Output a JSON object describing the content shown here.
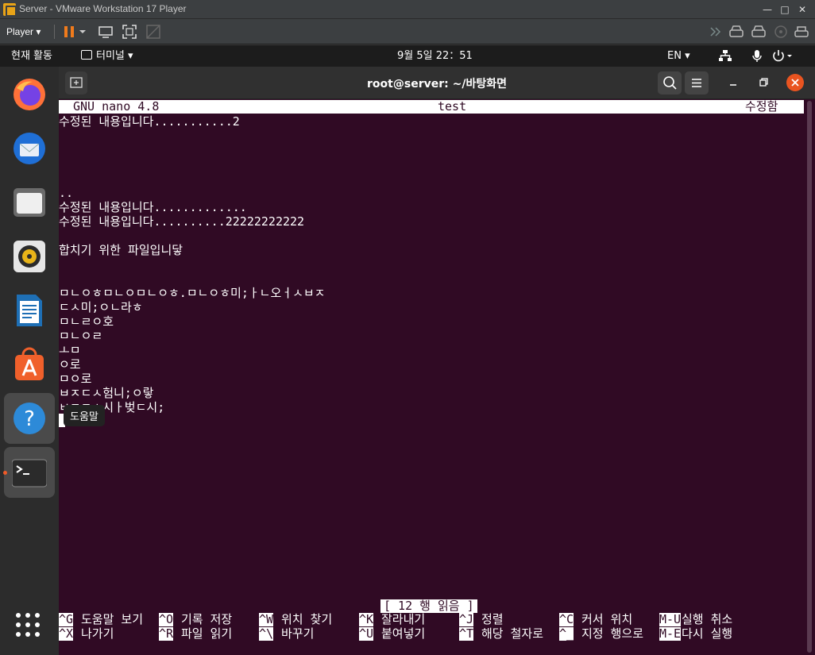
{
  "vm": {
    "title": "Server - VMware Workstation 17 Player",
    "player_menu": "Player"
  },
  "gnome": {
    "activities": "현재 활동",
    "app_menu": "터미널",
    "clock": "9월 5일  22：51",
    "lang": "EN"
  },
  "dock": {
    "items": [
      "firefox-icon",
      "thunderbird-icon",
      "files-icon",
      "rhythmbox-icon",
      "writer-icon",
      "software-icon",
      "help-icon",
      "terminal-icon"
    ],
    "tooltip": "도움말"
  },
  "terminal": {
    "title": "root@server: ~/바탕화면"
  },
  "nano": {
    "version": "GNU nano 4.8",
    "filename": "test",
    "modified": "수정함",
    "lines": [
      "수정된 내용입니다...........2",
      "",
      "",
      "",
      "",
      "..",
      "수정된 내용입니다.............",
      "수정된 내용입니다..........22222222222",
      "",
      "합치기 위한 파일입니닿",
      "",
      "",
      "ㅁㄴㅇㅎㅁㄴㅇㅁㄴㅇㅎ.ㅁㄴㅇㅎ미;ㅏㄴ오ㅓㅅㅂㅈ",
      "ㄷㅅ미;ㅇㄴ라ㅎ",
      "ㅁㄴㄹㅇ호",
      "ㅁㄴㅇㄹ",
      "ㅗㅁ",
      "ㅇ로",
      "ㅁㅇ로",
      "ㅂㅈㄷㅅ험니;ㅇ랗",
      "ㅂㅈㄷㅅ시ㅏ벚ㄷ시;"
    ],
    "status": "[ 12 행 읽음 ]",
    "shortcuts_row1": [
      {
        "key": "^G",
        "label": "도움말 보기"
      },
      {
        "key": "^O",
        "label": "기록 저장"
      },
      {
        "key": "^W",
        "label": "위치 찾기"
      },
      {
        "key": "^K",
        "label": "잘라내기"
      },
      {
        "key": "^J",
        "label": "정렬"
      },
      {
        "key": "^C",
        "label": "커서 위치"
      },
      {
        "key": "M-U",
        "label": "실행 취소"
      }
    ],
    "shortcuts_row2": [
      {
        "key": "^X",
        "label": "나가기"
      },
      {
        "key": "^R",
        "label": "파일 읽기"
      },
      {
        "key": "^\\",
        "label": "바꾸기"
      },
      {
        "key": "^U",
        "label": "붙여넣기"
      },
      {
        "key": "^T",
        "label": "해당 철자로"
      },
      {
        "key": "^_",
        "label": "지정 행으로"
      },
      {
        "key": "M-E",
        "label": "다시 실행"
      }
    ]
  }
}
